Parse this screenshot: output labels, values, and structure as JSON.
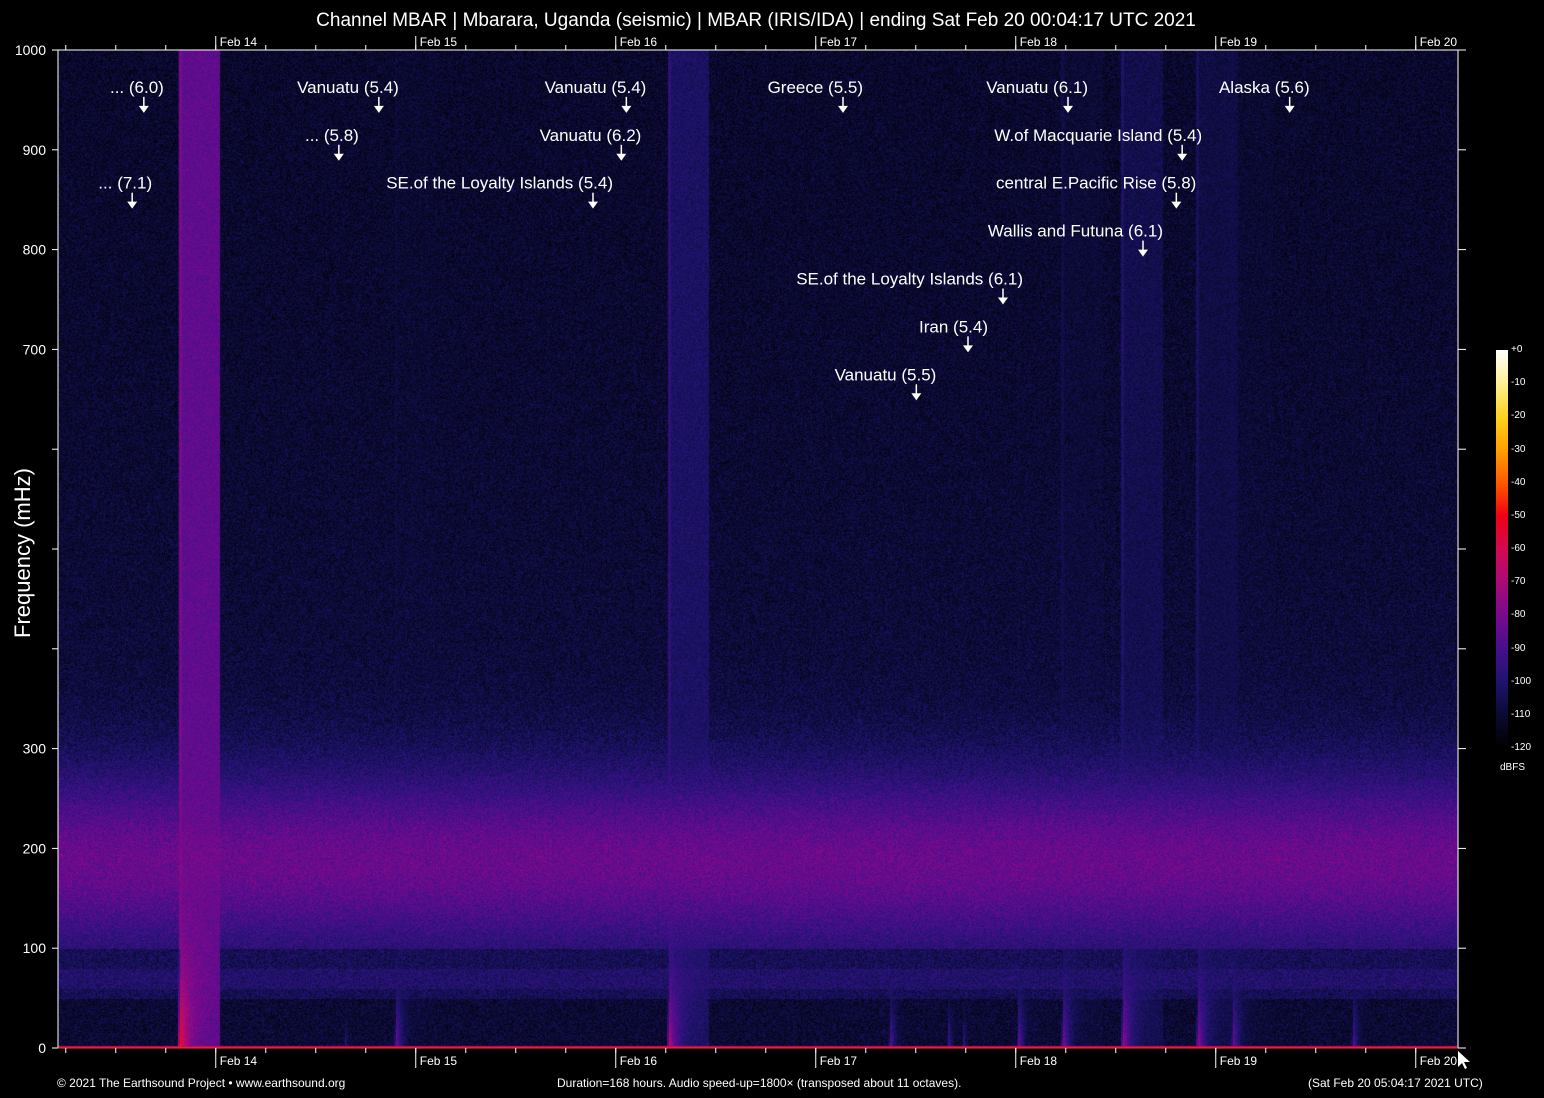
{
  "chart_data": {
    "type": "heatmap",
    "title": "Channel MBAR | Mbarara, Uganda (seismic) | MBAR (IRIS/IDA) | ending Sat Feb 20 00:04:17 UTC 2021",
    "xlabel": "",
    "ylabel": "Frequency (mHz)",
    "duration_hours": 168,
    "ylim": [
      0,
      1000
    ],
    "y_ticks": [
      0,
      100,
      200,
      300,
      400,
      500,
      600,
      700,
      800,
      900,
      1000
    ],
    "y_tick_labels": [
      "0",
      "100",
      "200",
      "300",
      "",
      "",
      "",
      "700",
      "800",
      "900",
      "1000"
    ],
    "x_day_ticks": [
      {
        "label": "Feb 14",
        "hours": 18.93
      },
      {
        "label": "Feb 15",
        "hours": 42.93
      },
      {
        "label": "Feb 16",
        "hours": 66.93
      },
      {
        "label": "Feb 17",
        "hours": 90.93
      },
      {
        "label": "Feb 18",
        "hours": 114.93
      },
      {
        "label": "Feb 19",
        "hours": 138.93
      },
      {
        "label": "Feb 20",
        "hours": 162.93
      }
    ],
    "colorbar": {
      "unit": "dBFS",
      "range": [
        -120,
        0
      ],
      "labels": [
        "+0",
        "-10",
        "-20",
        "-30",
        "-40",
        "-50",
        "-60",
        "-70",
        "-80",
        "-90",
        "-100",
        "-110",
        "-120"
      ]
    },
    "events": [
      {
        "label": "... (6.0)",
        "hours": 10.3,
        "freq_mHz": 937
      },
      {
        "label": "... (7.1)",
        "hours": 8.9,
        "freq_mHz": 841
      },
      {
        "label": "Vanuatu (5.4)",
        "hours": 38.5,
        "freq_mHz": 937
      },
      {
        "label": "... (5.8)",
        "hours": 33.7,
        "freq_mHz": 889
      },
      {
        "label": "Vanuatu (5.4)",
        "hours": 68.2,
        "freq_mHz": 937
      },
      {
        "label": "Vanuatu (6.2)",
        "hours": 67.6,
        "freq_mHz": 889
      },
      {
        "label": "SE.of the Loyalty Islands (5.4)",
        "hours": 64.2,
        "freq_mHz": 841
      },
      {
        "label": "Greece (5.5)",
        "hours": 94.2,
        "freq_mHz": 937
      },
      {
        "label": "Vanuatu (6.1)",
        "hours": 121.2,
        "freq_mHz": 937
      },
      {
        "label": "W.of Macquarie Island (5.4)",
        "hours": 134.9,
        "freq_mHz": 889
      },
      {
        "label": "central E.Pacific Rise (5.8)",
        "hours": 134.2,
        "freq_mHz": 841
      },
      {
        "label": "Wallis and Futuna (6.1)",
        "hours": 130.2,
        "freq_mHz": 793
      },
      {
        "label": "SE.of the Loyalty Islands (6.1)",
        "hours": 113.4,
        "freq_mHz": 745
      },
      {
        "label": "Iran (5.4)",
        "hours": 109.2,
        "freq_mHz": 697
      },
      {
        "label": "Vanuatu (5.5)",
        "hours": 103.0,
        "freq_mHz": 649
      },
      {
        "label": "Alaska (5.6)",
        "hours": 147.8,
        "freq_mHz": 937
      }
    ],
    "bright_streaks": [
      {
        "hours": 14.6,
        "peak_dB": -45
      },
      {
        "hours": 40.5,
        "peak_dB": -75
      },
      {
        "hours": 73.3,
        "peak_dB": -62
      },
      {
        "hours": 99.8,
        "peak_dB": -80
      },
      {
        "hours": 115.2,
        "peak_dB": -78
      },
      {
        "hours": 120.5,
        "peak_dB": -72
      },
      {
        "hours": 127.7,
        "peak_dB": -66
      },
      {
        "hours": 136.7,
        "peak_dB": -68
      },
      {
        "hours": 140.9,
        "peak_dB": -74
      },
      {
        "hours": 155.3,
        "peak_dB": -80
      },
      {
        "hours": 34.4,
        "peak_dB": -92
      },
      {
        "hours": 106.8,
        "peak_dB": -86
      },
      {
        "hours": 108.6,
        "peak_dB": -90
      },
      {
        "hours": 141.4,
        "peak_dB": -92
      }
    ]
  },
  "footer": {
    "copyright": "© 2021 The Earthsound Project • www.earthsound.org",
    "info": "Duration=168 hours. Audio speed-up=1800× (transposed about 11 octaves).",
    "local_time": "(Sat Feb 20 05:04:17 2021 UTC)"
  }
}
